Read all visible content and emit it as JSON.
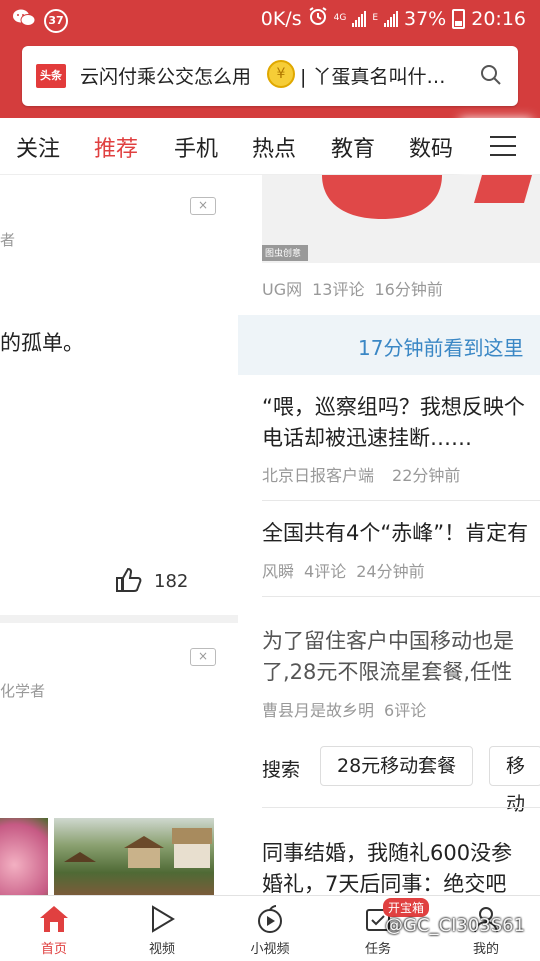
{
  "status_bar": {
    "notif_count": "37",
    "speed": "0K/s",
    "net1": "4G",
    "net2": "E",
    "battery": "37%",
    "time": "20:16"
  },
  "search": {
    "logo_text": "头条",
    "hint_1": "云闪付乘公交怎么用",
    "coin_symbol": "¥",
    "hint_2": "| 丫蛋真名叫什…"
  },
  "tabs": [
    "关注",
    "推荐",
    "手机",
    "热点",
    "教育",
    "数码"
  ],
  "active_tab": "推荐",
  "left_panel": {
    "card1": {
      "close": "×",
      "author_tail": "者",
      "text_tail": "的孤单。",
      "likes": "182"
    },
    "card2": {
      "close": "×",
      "author_tail": "化学者"
    }
  },
  "right_panel": {
    "hero_caption": "图虫创意",
    "article0_meta": {
      "source": "UG网",
      "comments": "13评论",
      "time": "16分钟前"
    },
    "recent_tip": "17分钟前看到这里",
    "article1": {
      "title_l1": "“喂，巡察组吗？我想反映个",
      "title_l2": "电话却被迅速挂断……",
      "source": "北京日报客户端",
      "time": "22分钟前"
    },
    "article2": {
      "title": "全国共有4个“赤峰”！肯定有",
      "source": "风瞬",
      "comments": "4评论",
      "time": "24分钟前"
    },
    "article3": {
      "title_l1": "为了留住客户中国移动也是",
      "title_l2": "了,28元不限流星套餐,任性",
      "source": "曹县月是故乡明",
      "comments": "6评论"
    },
    "search_row": {
      "label": "搜索",
      "chips": [
        "28元移动套餐",
        "移动"
      ]
    },
    "article4": {
      "title_l1": "同事结婚，我随礼600没参",
      "title_l2": "婚礼，7天后同事：绝交吧"
    }
  },
  "bottom_nav": {
    "items": [
      "首页",
      "视频",
      "小视频",
      "任务",
      "我的"
    ],
    "active": "首页",
    "task_badge": "开宝箱"
  },
  "watermark": "@GC_CI303S61",
  "colors": {
    "brand_red": "#d43d3d",
    "active_red": "#e04040",
    "link_blue": "#3a87c5"
  }
}
